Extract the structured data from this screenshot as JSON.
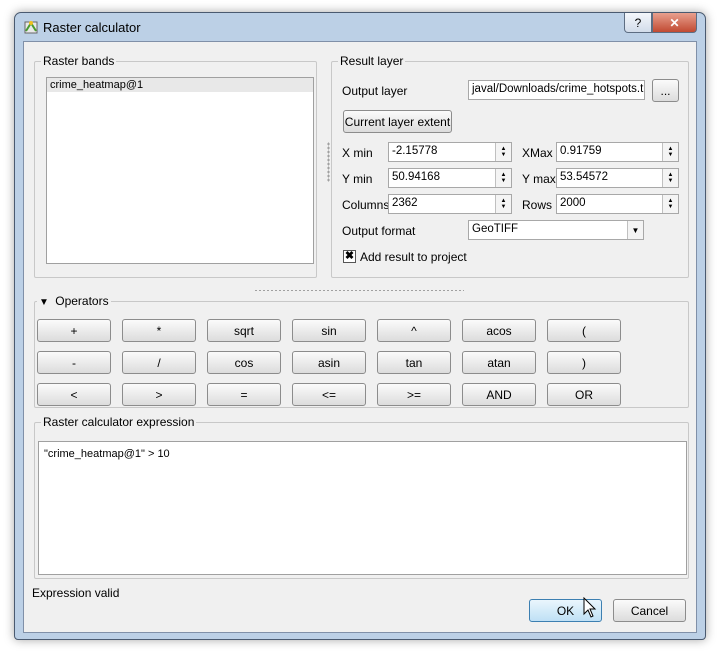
{
  "window": {
    "title": "Raster calculator",
    "help_label": "?",
    "close_label": "✕"
  },
  "raster_bands": {
    "title": "Raster bands",
    "items": [
      "crime_heatmap@1"
    ]
  },
  "result_layer": {
    "title": "Result layer",
    "output_layer_label": "Output layer",
    "output_layer_value": "javal/Downloads/crime_hotspots.tif",
    "browse_label": "...",
    "extent_button": "Current layer extent",
    "xmin_label": "X min",
    "xmin_value": "-2.15778",
    "xmax_label": "XMax",
    "xmax_value": "0.91759",
    "ymin_label": "Y min",
    "ymin_value": "50.94168",
    "ymax_label": "Y max",
    "ymax_value": "53.54572",
    "columns_label": "Columns",
    "columns_value": "2362",
    "rows_label": "Rows",
    "rows_value": "2000",
    "format_label": "Output format",
    "format_value": "GeoTIFF",
    "add_result_label": "Add result to project",
    "add_result_checked": true
  },
  "operators": {
    "title": "Operators",
    "row1": [
      "+",
      "*",
      "sqrt",
      "sin",
      "^",
      "acos",
      "("
    ],
    "row2": [
      "-",
      "/",
      "cos",
      "asin",
      "tan",
      "atan",
      ")"
    ],
    "row3": [
      "<",
      ">",
      "=",
      "<=",
      ">=",
      "AND",
      "OR"
    ]
  },
  "expression": {
    "title": "Raster calculator expression",
    "value": "\"crime_heatmap@1\" > 10"
  },
  "status": "Expression valid",
  "buttons": {
    "ok": "OK",
    "cancel": "Cancel"
  },
  "icons": {
    "app": "qgis-calculator-icon",
    "collapse": "triangle-down-icon",
    "spin": "spin-arrows-icon",
    "combo": "chevron-down-icon",
    "checkbox": "check-icon",
    "cursor": "mouse-pointer-icon"
  },
  "colors": {
    "titlebar": "#bcd0e6",
    "dialog_bg": "#f0f0f0",
    "close_button": "#c14a32",
    "default_button_border": "#3c7fb1"
  }
}
